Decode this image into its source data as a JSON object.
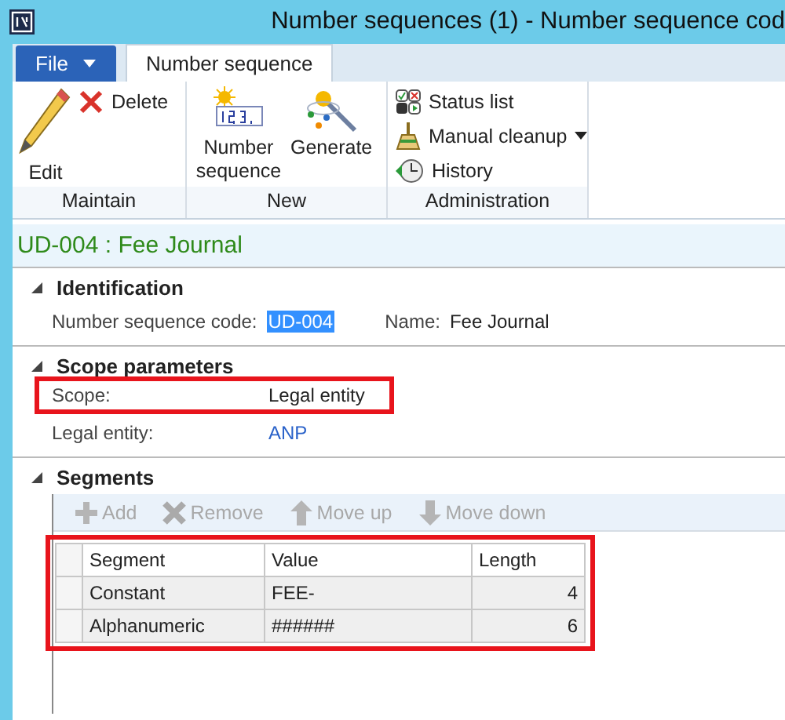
{
  "window": {
    "title": "Number sequences (1) - Number sequence cod"
  },
  "ribbon_tabs": [
    {
      "label": "File",
      "kind": "file",
      "selected": false
    },
    {
      "label": "Number sequence",
      "kind": "tab",
      "selected": true
    }
  ],
  "ribbon_groups": [
    {
      "label": "Maintain",
      "buttons": [
        {
          "label": "Edit",
          "kind": "large"
        },
        {
          "label": "Delete",
          "kind": "small"
        }
      ]
    },
    {
      "label": "New",
      "buttons": [
        {
          "label": "Number sequence",
          "kind": "large"
        },
        {
          "label": "Generate",
          "kind": "large"
        }
      ]
    },
    {
      "label": "Administration",
      "buttons": [
        {
          "label": "Status list",
          "kind": "small"
        },
        {
          "label": "Manual cleanup",
          "kind": "menu"
        },
        {
          "label": "History",
          "kind": "small"
        }
      ]
    }
  ],
  "record_title": "UD-004 : Fee Journal",
  "sections": [
    {
      "title": "Identification",
      "expanded": true,
      "kind": "fields",
      "fields": [
        {
          "label": "Number sequence code:",
          "value": "UD-004",
          "kind": "text",
          "selected": true
        },
        {
          "label": "Name:",
          "value": "Fee Journal",
          "kind": "text"
        }
      ]
    },
    {
      "title": "Scope parameters",
      "expanded": true,
      "kind": "fields",
      "fields": [
        {
          "label": "Scope:",
          "value": "Legal entity",
          "kind": "text",
          "highlighted": true
        },
        {
          "label": "Legal entity:",
          "value": "ANP",
          "kind": "link"
        }
      ]
    },
    {
      "title": "Segments",
      "expanded": true,
      "kind": "grid",
      "toolbar": [
        {
          "label": "Add",
          "disabled": true
        },
        {
          "label": "Remove",
          "disabled": true
        },
        {
          "label": "Move up",
          "disabled": true
        },
        {
          "label": "Move down",
          "disabled": true
        }
      ],
      "highlighted": true,
      "columns": [
        "Segment",
        "Value",
        "Length"
      ],
      "rows": [
        [
          "Constant",
          "FEE-",
          "4"
        ],
        [
          "Alphanumeric",
          "######",
          "6"
        ]
      ]
    }
  ]
}
